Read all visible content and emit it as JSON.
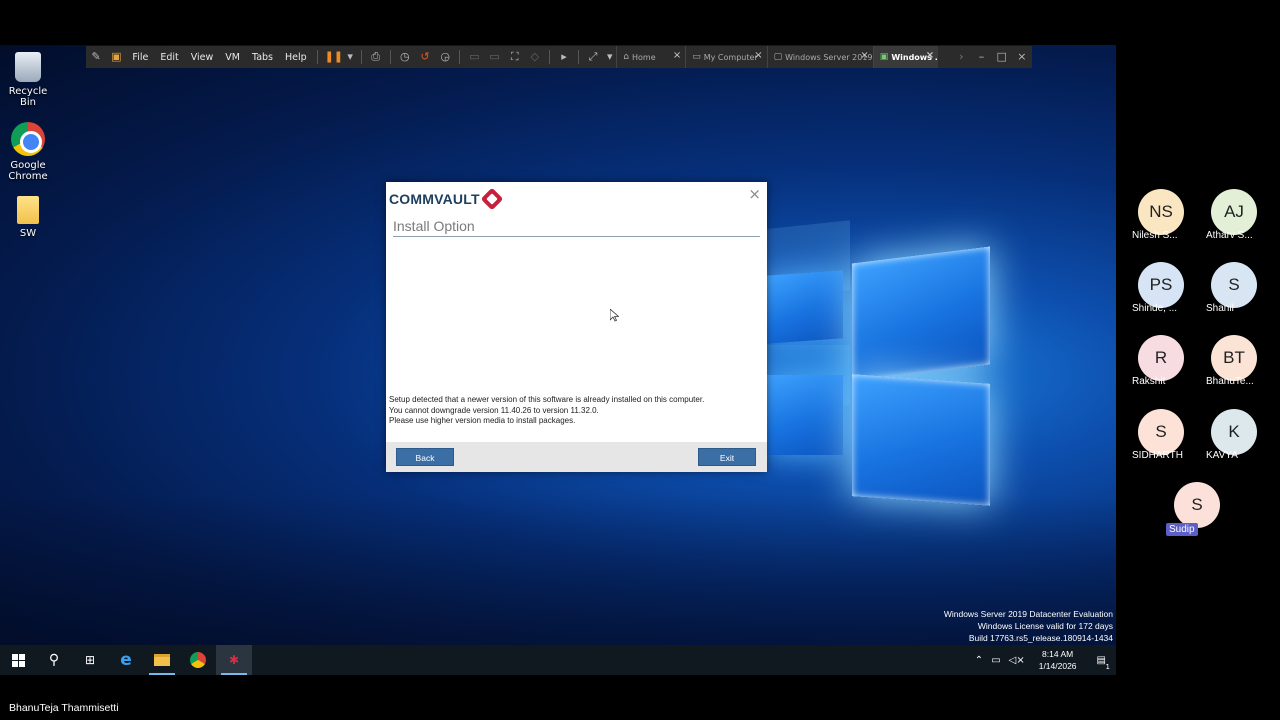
{
  "desktop": {
    "icons": [
      {
        "label": "Recycle Bin"
      },
      {
        "label": "Google Chrome"
      },
      {
        "label": "SW"
      }
    ],
    "watermark": {
      "line1": "Windows Server 2019 Datacenter Evaluation",
      "line2": "Windows License valid for 172 days",
      "line3": "Build 17763.rs5_release.180914-1434"
    }
  },
  "vm_toolbar": {
    "menus": [
      "File",
      "Edit",
      "View",
      "VM",
      "Tabs",
      "Help"
    ],
    "tabs": [
      {
        "label": "Home",
        "active": false
      },
      {
        "label": "My Computer",
        "active": false
      },
      {
        "label": "Windows Server 2019",
        "active": false
      },
      {
        "label": "Windows ...",
        "active": true
      }
    ]
  },
  "dialog": {
    "brand": "COMMVAULT",
    "heading": "Install Option",
    "message": [
      "Setup detected that a newer version of this software is already installed on this computer.",
      "You cannot downgrade version 11.40.26 to version 11.32.0.",
      "Please use higher version media to install packages."
    ],
    "back_label": "Back",
    "exit_label": "Exit",
    "close_glyph": "×"
  },
  "taskbar": {
    "time": "8:14 AM",
    "date": "1/14/2026",
    "notification_count": "1"
  },
  "participants": [
    {
      "initials": "NS",
      "name": "Nilesh S...",
      "color": "#fbe6c2"
    },
    {
      "initials": "AJ",
      "name": "Atharv S...",
      "color": "#e3f0d7"
    },
    {
      "initials": "PS",
      "name": "Shinde, ...",
      "color": "#d6e4f5"
    },
    {
      "initials": "S",
      "name": "Shanil",
      "color": "#d8e6f3"
    },
    {
      "initials": "R",
      "name": "Rakshit",
      "color": "#f7dde2"
    },
    {
      "initials": "BT",
      "name": "BhanuTe...",
      "color": "#fbe3d6"
    },
    {
      "initials": "S",
      "name": "SIDHARTH",
      "color": "#fde2d8"
    },
    {
      "initials": "K",
      "name": "KAVYA",
      "color": "#dde8ec"
    },
    {
      "initials": "S",
      "name": "Sudip",
      "color": "#fbe1d9"
    }
  ],
  "presenter": "BhanuTeja Thammisetti"
}
